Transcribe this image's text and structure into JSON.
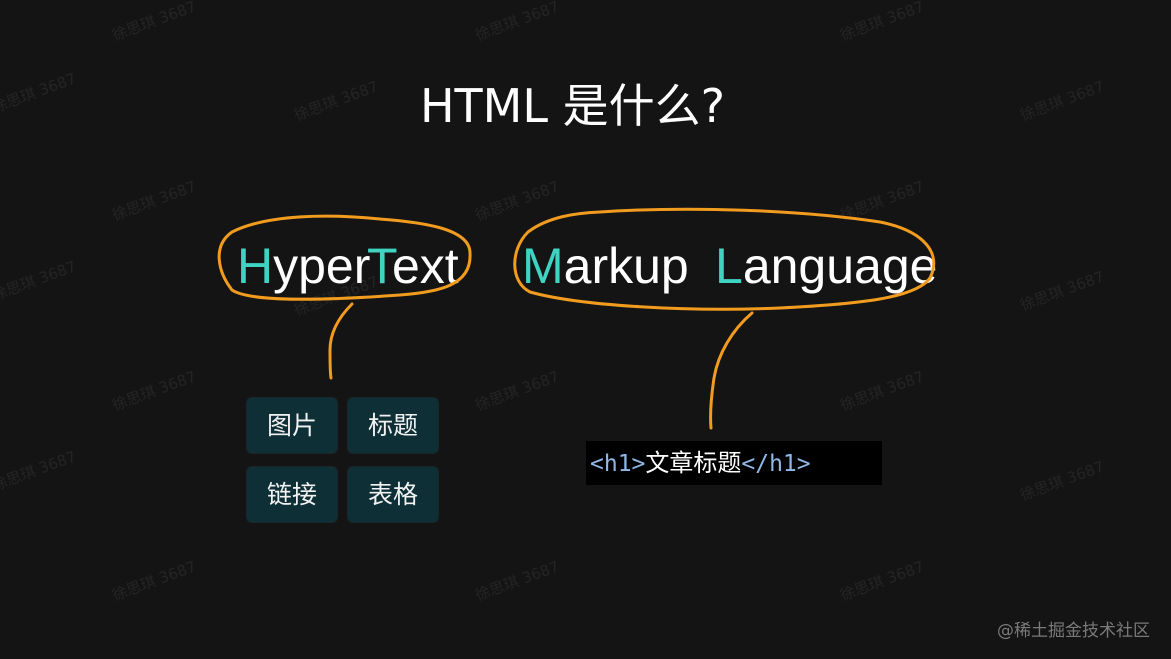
{
  "slide": {
    "title": "HTML 是什么?",
    "background": "#141414",
    "accent_color": "#3fd3c1",
    "annotation_color": "#f29c1f"
  },
  "acronym": {
    "hypertext": {
      "hyper_initial": "H",
      "hyper_rest": "yper",
      "text_initial": "T",
      "text_rest": "ext"
    },
    "markup": {
      "initial": "M",
      "rest": "arkup"
    },
    "language": {
      "initial": "L",
      "rest": "anguage"
    }
  },
  "hypertext_examples": [
    "图片",
    "标题",
    "链接",
    "表格"
  ],
  "markup_example": {
    "open_tag": "<h1>",
    "content": "文章标题",
    "close_tag": "</h1>"
  },
  "watermark": "徐思琪 3687",
  "credit": "@稀土掘金技术社区"
}
